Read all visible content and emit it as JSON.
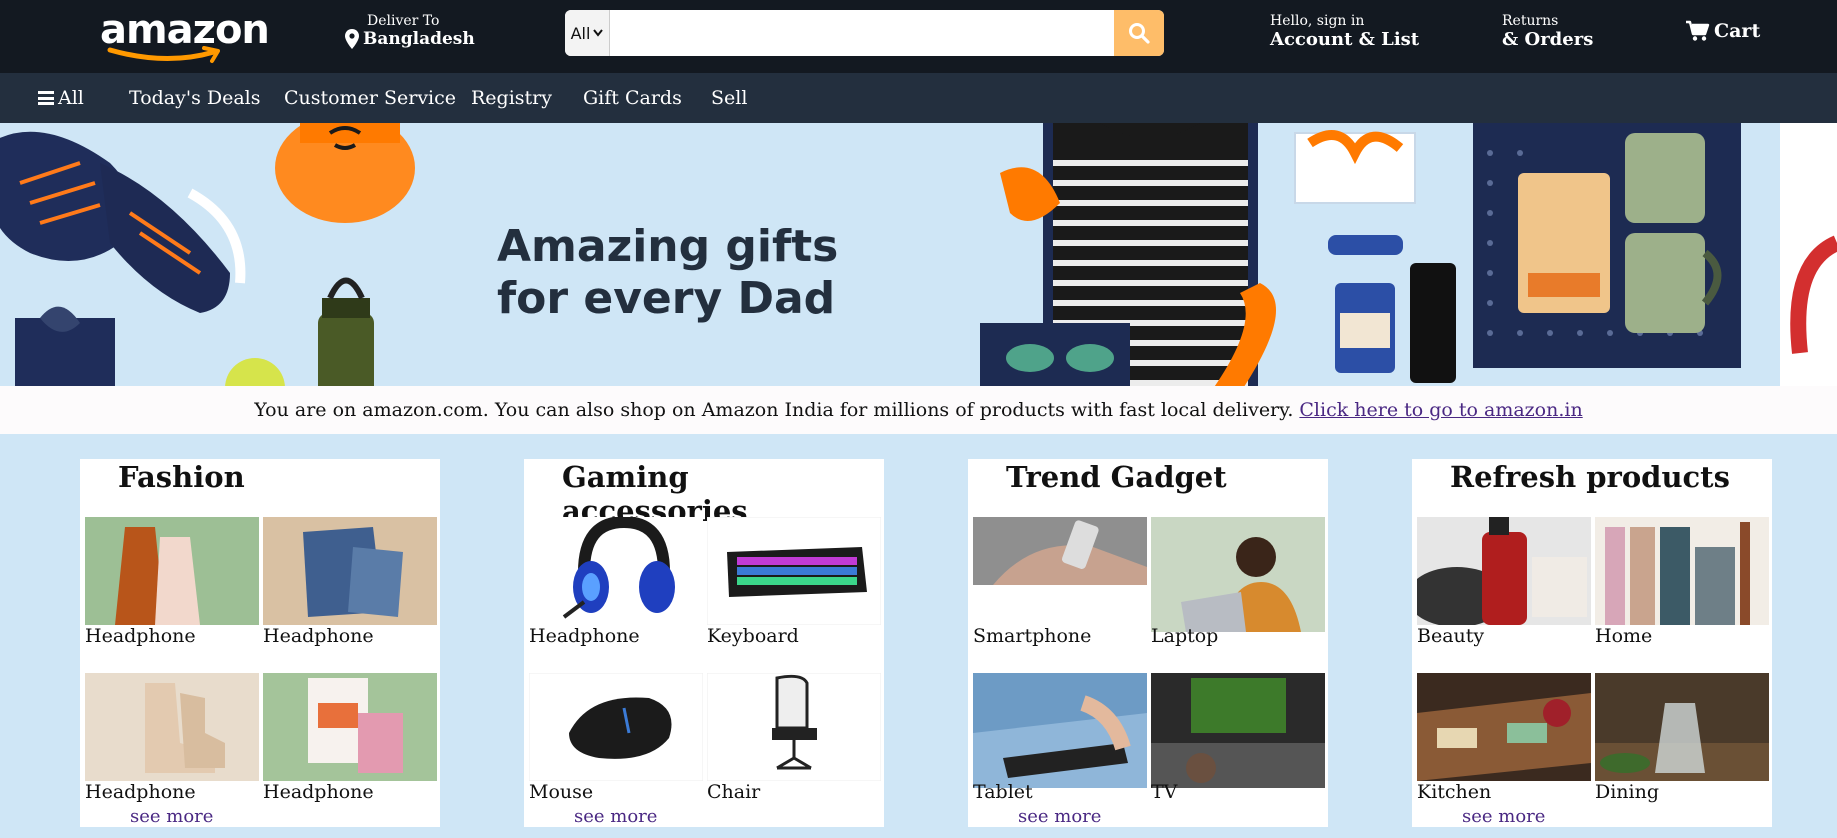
{
  "header": {
    "logo_text": "amazon",
    "deliver_label": "Deliver To",
    "deliver_location": "Bangladesh",
    "search": {
      "category": "All",
      "placeholder": "",
      "value": ""
    },
    "account_small": "Hello, sign in",
    "account_big": "Account & List",
    "returns_small": "Returns",
    "returns_big": "& Orders",
    "cart_label": "Cart"
  },
  "subnav": {
    "items": [
      "All",
      "Today's Deals",
      "Customer Service",
      "Registry",
      "Gift Cards",
      "Sell"
    ]
  },
  "hero": {
    "title_line1": "Amazing gifts",
    "title_line2": "for every Dad"
  },
  "notice": {
    "text": "You are on amazon.com. You can also shop on Amazon India for millions of products with fast local delivery.",
    "link_text": "Click here to go to amazon.in"
  },
  "cards": [
    {
      "title": "Fashion",
      "items": [
        "Headphone",
        "Headphone",
        "Headphone",
        "Headphone"
      ],
      "see_more": "see more"
    },
    {
      "title": "Gaming accessories",
      "items": [
        "Headphone",
        "Keyboard",
        "Mouse",
        "Chair"
      ],
      "see_more": "see more"
    },
    {
      "title": "Trend Gadget",
      "items": [
        "Smartphone",
        "Laptop",
        "Tablet",
        "TV"
      ],
      "see_more": "see more"
    },
    {
      "title": "Refresh products",
      "items": [
        "Beauty",
        "Home",
        "Kitchen",
        "Dining"
      ],
      "see_more": "see more"
    }
  ],
  "colors": {
    "nav_bg": "#131921",
    "subnav_bg": "#232f3e",
    "search_button": "#febd69",
    "hero_bg": "#cfe6f6",
    "link": "#4a2883"
  }
}
